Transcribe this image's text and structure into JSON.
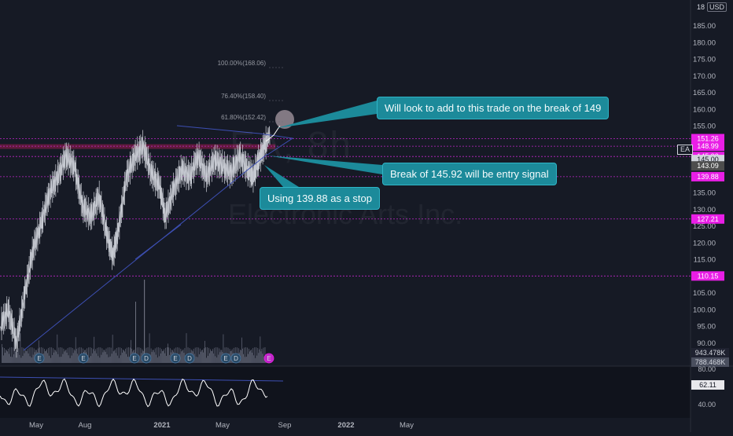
{
  "chart_data": {
    "type": "line",
    "symbol": "EA, 8h",
    "company": "Electronic Arts Inc.",
    "currency": "USD",
    "y_axis_ticks": [
      185,
      180,
      175,
      170,
      165,
      160,
      155,
      150,
      145,
      140,
      135,
      130,
      125,
      120,
      115,
      110,
      105,
      100,
      95,
      90
    ],
    "ylim": [
      88,
      186
    ],
    "x_axis_ticks": [
      "May",
      "Aug",
      "2021",
      "May",
      "Sep",
      "2022",
      "May"
    ],
    "rsi_ticks": [
      "80.00",
      "40.00"
    ],
    "rsi_value": "62.11",
    "price_labels": [
      {
        "text": "151.26",
        "value": 151.26,
        "color": "#e91ee6"
      },
      {
        "text": "148.99",
        "value": 148.99,
        "color": "#e91ee6"
      },
      {
        "text": "145.92",
        "value": 145.92,
        "color": "#e91ee6"
      },
      {
        "text": "145.00",
        "value": 145.0,
        "color": "#d1d4dc"
      },
      {
        "text": "143.09",
        "value": 143.09,
        "color": "#4d4d4d"
      },
      {
        "text": "139.88",
        "value": 139.88,
        "color": "#e91ee6"
      },
      {
        "text": "127.21",
        "value": 127.21,
        "color": "#e91ee6"
      },
      {
        "text": "110.15",
        "value": 110.15,
        "color": "#e91ee6"
      }
    ],
    "volume_labels": [
      "943.478K",
      "788.468K"
    ],
    "symbol_tag": "EA",
    "levels": [
      151.26,
      148.99,
      145.92,
      139.88,
      127.21,
      110.15
    ],
    "fib_labels": [
      {
        "text": "100.00%(168.06)",
        "value": 168.06
      },
      {
        "text": "76.40%(158.40)",
        "value": 158.4
      },
      {
        "text": "61.80%(152.42)",
        "value": 152.42
      }
    ],
    "earnings_markers": [
      "E",
      "E",
      "E",
      "D",
      "E",
      "D",
      "E",
      "D",
      "E",
      "E"
    ],
    "annotations": [
      "Will look to add to this trade on the break of 149",
      "Break of 145.92 will be entry signal",
      "Using 139.88 as a stop"
    ],
    "price_path": [
      [
        0,
        95
      ],
      [
        0.015,
        100
      ],
      [
        0.03,
        90
      ],
      [
        0.045,
        105
      ],
      [
        0.06,
        118
      ],
      [
        0.075,
        126
      ],
      [
        0.09,
        135
      ],
      [
        0.105,
        140
      ],
      [
        0.12,
        146
      ],
      [
        0.135,
        143
      ],
      [
        0.15,
        131
      ],
      [
        0.165,
        128
      ],
      [
        0.18,
        134
      ],
      [
        0.195,
        122
      ],
      [
        0.205,
        116
      ],
      [
        0.215,
        124
      ],
      [
        0.23,
        140
      ],
      [
        0.245,
        146
      ],
      [
        0.26,
        149
      ],
      [
        0.275,
        141
      ],
      [
        0.29,
        137
      ],
      [
        0.3,
        128
      ],
      [
        0.315,
        136
      ],
      [
        0.33,
        142
      ],
      [
        0.345,
        140
      ],
      [
        0.36,
        146
      ],
      [
        0.375,
        140
      ],
      [
        0.39,
        145
      ],
      [
        0.405,
        143
      ],
      [
        0.42,
        141
      ],
      [
        0.435,
        146
      ],
      [
        0.45,
        142
      ],
      [
        0.46,
        140
      ],
      [
        0.47,
        145
      ],
      [
        0.48,
        149
      ],
      [
        0.49,
        152.4
      ]
    ]
  }
}
